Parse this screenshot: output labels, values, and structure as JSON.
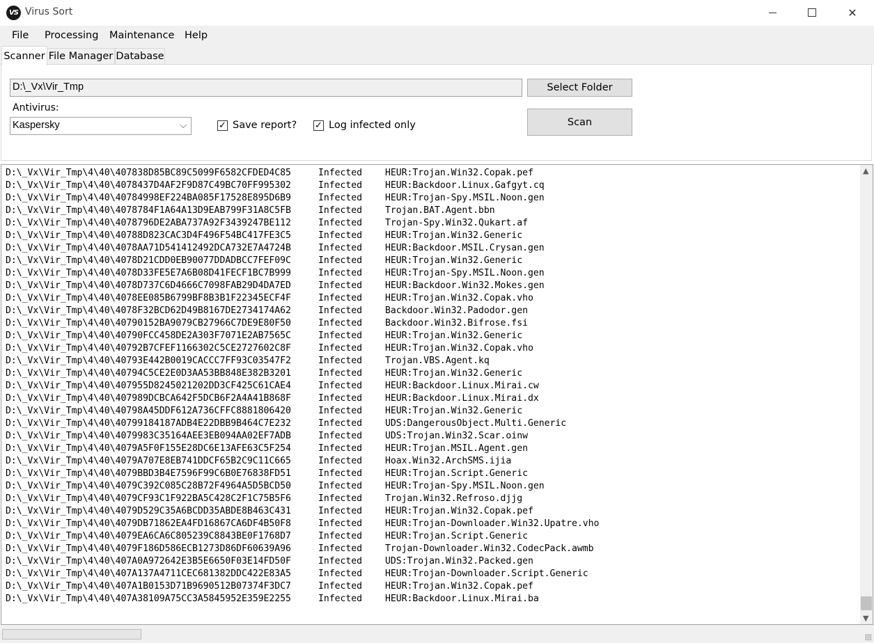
{
  "window": {
    "title": "Virus Sort",
    "icon_text": "VS",
    "icon": "virus-sort-logo",
    "controls": {
      "minimize": "minimize-icon",
      "maximize": "maximize-icon",
      "close": "close-icon",
      "close_glyph": "✕"
    }
  },
  "menu": [
    "File",
    "Processing",
    "Maintenance",
    "Help"
  ],
  "tabs": [
    "Scanner",
    "File Manager",
    "Database"
  ],
  "active_tab": "Scanner",
  "scanner": {
    "folder_value": "D:\\_Vx\\Vir_Tmp",
    "select_folder_label": "Select Folder",
    "antivirus_label": "Antivirus:",
    "antivirus_value": "Kaspersky",
    "antivirus_chevron": "⌵",
    "save_report_label": "Save report?",
    "save_report_checked": true,
    "log_infected_label": "Log infected only",
    "log_infected_checked": true,
    "check_glyph": "✓",
    "scan_label": "Scan"
  },
  "results": [
    {
      "path": "D:\\_Vx\\Vir_Tmp\\4\\40\\407838D85BC89C5099F6582CFDED4C85",
      "status": "Infected",
      "threat": "HEUR:Trojan.Win32.Copak.pef"
    },
    {
      "path": "D:\\_Vx\\Vir_Tmp\\4\\40\\4078437D4AF2F9D87C49BC70FF995302",
      "status": "Infected",
      "threat": "HEUR:Backdoor.Linux.Gafgyt.cq"
    },
    {
      "path": "D:\\_Vx\\Vir_Tmp\\4\\40\\40784998EF224BA085F17528E895D6B9",
      "status": "Infected",
      "threat": "HEUR:Trojan-Spy.MSIL.Noon.gen"
    },
    {
      "path": "D:\\_Vx\\Vir_Tmp\\4\\40\\4078784F1A64A13D9EAB799F31A8C5FB",
      "status": "Infected",
      "threat": "Trojan.BAT.Agent.bbn"
    },
    {
      "path": "D:\\_Vx\\Vir_Tmp\\4\\40\\4078796DE2ABA737A92F3439247BE112",
      "status": "Infected",
      "threat": "Trojan-Spy.Win32.Qukart.af"
    },
    {
      "path": "D:\\_Vx\\Vir_Tmp\\4\\40\\40788D823CAC3D4F496F54BC417FE3C5",
      "status": "Infected",
      "threat": "HEUR:Trojan.Win32.Generic"
    },
    {
      "path": "D:\\_Vx\\Vir_Tmp\\4\\40\\4078AA71D541412492DCA732E7A4724B",
      "status": "Infected",
      "threat": "HEUR:Backdoor.MSIL.Crysan.gen"
    },
    {
      "path": "D:\\_Vx\\Vir_Tmp\\4\\40\\4078D21CDD0EB90077DDADBCC7FEF09C",
      "status": "Infected",
      "threat": "HEUR:Trojan.Win32.Generic"
    },
    {
      "path": "D:\\_Vx\\Vir_Tmp\\4\\40\\4078D33FE5E7A6B08D41FECF1BC7B999",
      "status": "Infected",
      "threat": "HEUR:Trojan-Spy.MSIL.Noon.gen"
    },
    {
      "path": "D:\\_Vx\\Vir_Tmp\\4\\40\\4078D737C6D4666C7098FAB29D4DA7ED",
      "status": "Infected",
      "threat": "HEUR:Backdoor.Win32.Mokes.gen"
    },
    {
      "path": "D:\\_Vx\\Vir_Tmp\\4\\40\\4078EE085B6799BF8B3B1F22345ECF4F",
      "status": "Infected",
      "threat": "HEUR:Trojan.Win32.Copak.vho"
    },
    {
      "path": "D:\\_Vx\\Vir_Tmp\\4\\40\\4078F32BCD62D49B8167DE2734174A62",
      "status": "Infected",
      "threat": "Backdoor.Win32.Padodor.gen"
    },
    {
      "path": "D:\\_Vx\\Vir_Tmp\\4\\40\\40790152BA9079CB27966C7DE9E80F50",
      "status": "Infected",
      "threat": "Backdoor.Win32.Bifrose.fsi"
    },
    {
      "path": "D:\\_Vx\\Vir_Tmp\\4\\40\\40790FCC458DE2A303F7071E2AB7565C",
      "status": "Infected",
      "threat": "HEUR:Trojan.Win32.Generic"
    },
    {
      "path": "D:\\_Vx\\Vir_Tmp\\4\\40\\40792B7CFEF1166302C5CE2727602C8F",
      "status": "Infected",
      "threat": "HEUR:Trojan.Win32.Copak.vho"
    },
    {
      "path": "D:\\_Vx\\Vir_Tmp\\4\\40\\40793E442B0019CACCC7FF93C03547F2",
      "status": "Infected",
      "threat": "Trojan.VBS.Agent.kq"
    },
    {
      "path": "D:\\_Vx\\Vir_Tmp\\4\\40\\40794C5CE2E0D3AA53BB848E382B3201",
      "status": "Infected",
      "threat": "HEUR:Trojan.Win32.Generic"
    },
    {
      "path": "D:\\_Vx\\Vir_Tmp\\4\\40\\407955D8245021202DD3CF425C61CAE4",
      "status": "Infected",
      "threat": "HEUR:Backdoor.Linux.Mirai.cw"
    },
    {
      "path": "D:\\_Vx\\Vir_Tmp\\4\\40\\407989DCBCA642F5DCB6F2A4A41B868F",
      "status": "Infected",
      "threat": "HEUR:Backdoor.Linux.Mirai.dx"
    },
    {
      "path": "D:\\_Vx\\Vir_Tmp\\4\\40\\40798A45DDF612A736CFFC8881806420",
      "status": "Infected",
      "threat": "HEUR:Trojan.Win32.Generic"
    },
    {
      "path": "D:\\_Vx\\Vir_Tmp\\4\\40\\40799184187ADB4E22DBB9B464C7E232",
      "status": "Infected",
      "threat": "UDS:DangerousObject.Multi.Generic"
    },
    {
      "path": "D:\\_Vx\\Vir_Tmp\\4\\40\\4079983C35164AEE3EB094AA02EF7ADB",
      "status": "Infected",
      "threat": "UDS:Trojan.Win32.Scar.oinw"
    },
    {
      "path": "D:\\_Vx\\Vir_Tmp\\4\\40\\4079A5F0F155E28DC6E13AFE63C5F254",
      "status": "Infected",
      "threat": "HEUR:Trojan.MSIL.Agent.gen"
    },
    {
      "path": "D:\\_Vx\\Vir_Tmp\\4\\40\\4079A707E8EB741DDCF65B2C9C11C665",
      "status": "Infected",
      "threat": "Hoax.Win32.ArchSMS.ijia"
    },
    {
      "path": "D:\\_Vx\\Vir_Tmp\\4\\40\\4079BBD3B4E7596F99C6B0E76838FD51",
      "status": "Infected",
      "threat": "HEUR:Trojan.Script.Generic"
    },
    {
      "path": "D:\\_Vx\\Vir_Tmp\\4\\40\\4079C392C085C28B72F4964A5D5BCD50",
      "status": "Infected",
      "threat": "HEUR:Trojan-Spy.MSIL.Noon.gen"
    },
    {
      "path": "D:\\_Vx\\Vir_Tmp\\4\\40\\4079CF93C1F922BA5C428C2F1C75B5F6",
      "status": "Infected",
      "threat": "Trojan.Win32.Refroso.djjg"
    },
    {
      "path": "D:\\_Vx\\Vir_Tmp\\4\\40\\4079D529C35A6BCDD35ABDE8B463C431",
      "status": "Infected",
      "threat": "HEUR:Trojan.Win32.Copak.pef"
    },
    {
      "path": "D:\\_Vx\\Vir_Tmp\\4\\40\\4079DB71862EA4FD16867CA6DF4B50F8",
      "status": "Infected",
      "threat": "HEUR:Trojan-Downloader.Win32.Upatre.vho"
    },
    {
      "path": "D:\\_Vx\\Vir_Tmp\\4\\40\\4079EA6CA6C805239C8843BE0F1768D7",
      "status": "Infected",
      "threat": "HEUR:Trojan.Script.Generic"
    },
    {
      "path": "D:\\_Vx\\Vir_Tmp\\4\\40\\4079F186D586ECB1273D86DF60639A96",
      "status": "Infected",
      "threat": "Trojan-Downloader.Win32.CodecPack.awmb"
    },
    {
      "path": "D:\\_Vx\\Vir_Tmp\\4\\40\\407A0A972642E3B5E6650F03E14FD50F",
      "status": "Infected",
      "threat": "UDS:Trojan.Win32.Packed.gen"
    },
    {
      "path": "D:\\_Vx\\Vir_Tmp\\4\\40\\407A137A4711CEC681382DDC422E83A5",
      "status": "Infected",
      "threat": "HEUR:Trojan-Downloader.Script.Generic"
    },
    {
      "path": "D:\\_Vx\\Vir_Tmp\\4\\40\\407A1B0153D71B9690512B07374F3DC7",
      "status": "Infected",
      "threat": "HEUR:Trojan.Win32.Copak.pef"
    },
    {
      "path": "D:\\_Vx\\Vir_Tmp\\4\\40\\407A38109A75CC3A5845952E359E2255",
      "status": "Infected",
      "threat": "HEUR:Backdoor.Linux.Mirai.ba"
    }
  ],
  "scrollbar": {
    "up": "▲",
    "down": "▼",
    "position_fraction": 0.97
  },
  "progress": {
    "value": 0
  },
  "colors": {
    "chrome": "#f0f0f0",
    "button": "#e1e1e1",
    "progress_fill": "#06b025"
  }
}
